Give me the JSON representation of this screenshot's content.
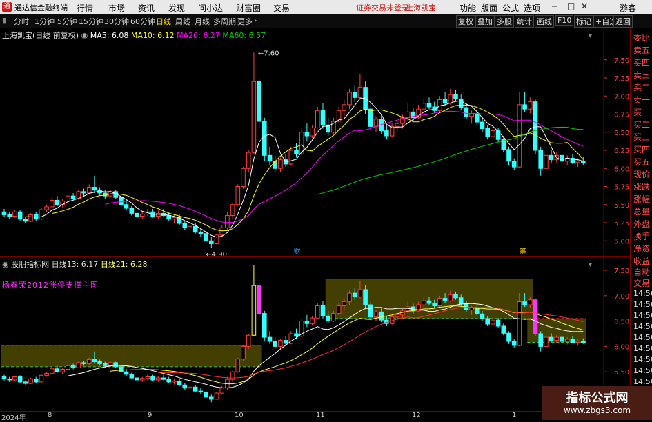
{
  "app": {
    "name": "通达信金融终端",
    "logo": "通"
  },
  "menu": [
    "行情",
    "市场",
    "资讯",
    "发现",
    "问小达",
    "财富圈",
    "交易"
  ],
  "notice": "证券交易未登录",
  "notice_stock": "上海凯宝",
  "right_menu": [
    "功能",
    "版面",
    "公式",
    "选项"
  ],
  "user": "游客",
  "period_tabs": [
    "分时",
    "1分钟",
    "5分钟",
    "15分钟",
    "30分钟",
    "60分钟",
    "日线",
    "周线",
    "月线",
    "多周期",
    "更多"
  ],
  "active_period": "日线",
  "tools": [
    "复权",
    "叠加",
    "多股",
    "统计",
    "画线",
    "F10",
    "标记",
    "+自选",
    "返回"
  ],
  "main_legend": {
    "title": "上海凯宝(日线 前复权)",
    "ma5": "MA5: 6.08",
    "ma10": "MA10: 6.12",
    "ma20": "MA20: 6.27",
    "ma60": "MA60: 6.57"
  },
  "sub_legend": {
    "title": "股朋指标网",
    "l13": "日线13: 6.17",
    "l21": "日线21: 6.28",
    "author": "杨春荣2012涨停支撑主图"
  },
  "main_axis": [
    "7.50",
    "7.25",
    "7.00",
    "6.75",
    "6.50",
    "6.25",
    "6.00",
    "5.75",
    "5.50",
    "5.25",
    "5.00"
  ],
  "sub_axis": [
    "7.50",
    "7.00",
    "6.50",
    "6.00",
    "5.50"
  ],
  "annotations": {
    "high": "7.60",
    "low": "4.90",
    "cai": "财",
    "chou": "筹"
  },
  "side_quote": [
    "委比",
    "卖五",
    "卖四",
    "卖三",
    "卖二",
    "卖一",
    "买一",
    "买二",
    "买三",
    "买四",
    "买五",
    "现价",
    "涨跌",
    "涨幅",
    "总量",
    "外盘",
    "换手",
    "净资",
    "收益"
  ],
  "side_trade": [
    "自动",
    "交易"
  ],
  "side_times": [
    "14:56",
    "14:56",
    "14:56",
    "14:56",
    "14:56",
    "14:56",
    "14:56",
    "14:56",
    "14:56"
  ],
  "dates": [
    "2024年",
    "8",
    "9",
    "10",
    "11",
    "12",
    "1"
  ],
  "watermark": {
    "title": "指标公式网",
    "url": "www.zbgs3.com"
  },
  "colors": {
    "up": "#ff3c3c",
    "down": "#33ffff",
    "ma5": "#ffffff",
    "ma10": "#ffff00",
    "ma20": "#ff00ff",
    "ma60": "#00cc00",
    "zone": "#4d4a00"
  },
  "chart_data": {
    "type": "candlestick",
    "ylim": [
      4.85,
      7.65
    ],
    "candles": [
      [
        5.4,
        5.44,
        5.33,
        5.36
      ],
      [
        5.36,
        5.4,
        5.3,
        5.34
      ],
      [
        5.34,
        5.42,
        5.32,
        5.4
      ],
      [
        5.4,
        5.43,
        5.28,
        5.3
      ],
      [
        5.3,
        5.33,
        5.25,
        5.27
      ],
      [
        5.27,
        5.38,
        5.26,
        5.36
      ],
      [
        5.36,
        5.4,
        5.28,
        5.3
      ],
      [
        5.3,
        5.45,
        5.29,
        5.43
      ],
      [
        5.43,
        5.5,
        5.4,
        5.47
      ],
      [
        5.47,
        5.6,
        5.45,
        5.56
      ],
      [
        5.56,
        5.62,
        5.48,
        5.5
      ],
      [
        5.5,
        5.58,
        5.46,
        5.55
      ],
      [
        5.55,
        5.66,
        5.52,
        5.62
      ],
      [
        5.62,
        5.66,
        5.55,
        5.58
      ],
      [
        5.58,
        5.7,
        5.57,
        5.68
      ],
      [
        5.68,
        5.72,
        5.62,
        5.66
      ],
      [
        5.66,
        5.78,
        5.64,
        5.74
      ],
      [
        5.74,
        5.9,
        5.66,
        5.7
      ],
      [
        5.7,
        5.74,
        5.62,
        5.66
      ],
      [
        5.66,
        5.7,
        5.58,
        5.62
      ],
      [
        5.62,
        5.7,
        5.6,
        5.68
      ],
      [
        5.68,
        5.7,
        5.58,
        5.6
      ],
      [
        5.6,
        5.63,
        5.48,
        5.5
      ],
      [
        5.5,
        5.56,
        5.42,
        5.45
      ],
      [
        5.45,
        5.48,
        5.35,
        5.38
      ],
      [
        5.38,
        5.42,
        5.32,
        5.34
      ],
      [
        5.34,
        5.4,
        5.3,
        5.37
      ],
      [
        5.37,
        5.44,
        5.34,
        5.4
      ],
      [
        5.4,
        5.44,
        5.32,
        5.34
      ],
      [
        5.34,
        5.42,
        5.3,
        5.38
      ],
      [
        5.38,
        5.44,
        5.33,
        5.35
      ],
      [
        5.35,
        5.4,
        5.28,
        5.3
      ],
      [
        5.3,
        5.36,
        5.25,
        5.32
      ],
      [
        5.32,
        5.36,
        5.22,
        5.24
      ],
      [
        5.24,
        5.28,
        5.15,
        5.18
      ],
      [
        5.18,
        5.24,
        5.12,
        5.2
      ],
      [
        5.2,
        5.24,
        5.1,
        5.12
      ],
      [
        5.12,
        5.18,
        5.06,
        5.1
      ],
      [
        5.1,
        5.14,
        4.98,
        5.0
      ],
      [
        5.0,
        5.05,
        4.9,
        4.96
      ],
      [
        4.96,
        5.1,
        4.95,
        5.08
      ],
      [
        5.08,
        5.22,
        5.05,
        5.18
      ],
      [
        5.18,
        5.4,
        5.15,
        5.35
      ],
      [
        5.35,
        5.52,
        5.3,
        5.5
      ],
      [
        5.5,
        5.78,
        5.48,
        5.75
      ],
      [
        5.75,
        6.02,
        5.72,
        6.0
      ],
      [
        6.0,
        6.25,
        5.95,
        6.22
      ],
      [
        6.22,
        7.6,
        6.2,
        7.2
      ],
      [
        7.2,
        7.25,
        6.55,
        6.65
      ],
      [
        6.65,
        6.7,
        6.1,
        6.18
      ],
      [
        6.18,
        6.3,
        6.05,
        6.1
      ],
      [
        6.1,
        6.18,
        5.95,
        6.0
      ],
      [
        6.0,
        6.15,
        5.95,
        6.12
      ],
      [
        6.12,
        6.2,
        6.02,
        6.06
      ],
      [
        6.06,
        6.3,
        6.04,
        6.25
      ],
      [
        6.25,
        6.35,
        6.15,
        6.2
      ],
      [
        6.2,
        6.55,
        6.18,
        6.5
      ],
      [
        6.5,
        6.62,
        6.38,
        6.45
      ],
      [
        6.45,
        6.6,
        6.42,
        6.56
      ],
      [
        6.56,
        6.85,
        6.55,
        6.8
      ],
      [
        6.8,
        6.9,
        6.55,
        6.6
      ],
      [
        6.6,
        6.7,
        6.45,
        6.5
      ],
      [
        6.5,
        6.7,
        6.48,
        6.65
      ],
      [
        6.65,
        6.85,
        6.62,
        6.8
      ],
      [
        6.8,
        6.95,
        6.7,
        6.88
      ],
      [
        6.88,
        7.1,
        6.82,
        7.05
      ],
      [
        7.05,
        7.15,
        6.92,
        6.98
      ],
      [
        6.98,
        7.3,
        6.95,
        7.12
      ],
      [
        7.12,
        7.2,
        6.75,
        6.82
      ],
      [
        6.82,
        6.88,
        6.55,
        6.58
      ],
      [
        6.58,
        6.72,
        6.5,
        6.68
      ],
      [
        6.68,
        6.75,
        6.48,
        6.52
      ],
      [
        6.52,
        6.6,
        6.4,
        6.45
      ],
      [
        6.45,
        6.62,
        6.43,
        6.58
      ],
      [
        6.58,
        6.66,
        6.5,
        6.62
      ],
      [
        6.62,
        6.74,
        6.55,
        6.7
      ],
      [
        6.7,
        6.9,
        6.66,
        6.78
      ],
      [
        6.78,
        6.84,
        6.64,
        6.7
      ],
      [
        6.7,
        6.88,
        6.68,
        6.82
      ],
      [
        6.82,
        6.96,
        6.78,
        6.9
      ],
      [
        6.9,
        6.98,
        6.82,
        6.85
      ],
      [
        6.85,
        6.92,
        6.76,
        6.8
      ],
      [
        6.8,
        7.0,
        6.78,
        6.95
      ],
      [
        6.95,
        7.05,
        6.86,
        6.9
      ],
      [
        6.9,
        7.1,
        6.88,
        7.02
      ],
      [
        7.02,
        7.08,
        6.92,
        6.96
      ],
      [
        6.96,
        7.02,
        6.8,
        6.84
      ],
      [
        6.84,
        6.9,
        6.68,
        6.72
      ],
      [
        6.72,
        6.8,
        6.62,
        6.76
      ],
      [
        6.76,
        6.82,
        6.6,
        6.64
      ],
      [
        6.64,
        6.7,
        6.5,
        6.55
      ],
      [
        6.55,
        6.6,
        6.4,
        6.44
      ],
      [
        6.44,
        6.58,
        6.4,
        6.52
      ],
      [
        6.52,
        6.56,
        6.36,
        6.4
      ],
      [
        6.4,
        6.45,
        6.22,
        6.26
      ],
      [
        6.26,
        6.3,
        6.05,
        6.1
      ],
      [
        6.1,
        6.14,
        5.98,
        6.02
      ],
      [
        6.02,
        7.05,
        6.0,
        6.88
      ],
      [
        6.88,
        7.05,
        6.78,
        6.82
      ],
      [
        6.82,
        6.98,
        6.76,
        6.92
      ],
      [
        6.92,
        6.95,
        6.2,
        6.25
      ],
      [
        6.25,
        6.3,
        5.9,
        6.0
      ],
      [
        6.0,
        6.2,
        5.95,
        6.18
      ],
      [
        6.18,
        6.26,
        6.08,
        6.12
      ],
      [
        6.12,
        6.22,
        6.08,
        6.18
      ],
      [
        6.18,
        6.22,
        6.05,
        6.1
      ],
      [
        6.1,
        6.18,
        6.04,
        6.14
      ],
      [
        6.14,
        6.2,
        6.06,
        6.08
      ],
      [
        6.08,
        6.14,
        6.02,
        6.1
      ],
      [
        6.1,
        6.16,
        6.05,
        6.08
      ]
    ],
    "sub_zones": [
      {
        "x_from": 0,
        "x_to": 48,
        "top": 6.02,
        "bottom": 5.6
      },
      {
        "x_from": 61,
        "x_to": 99,
        "top": 7.33,
        "bottom": 6.55
      },
      {
        "x_from": 99,
        "x_to": 109,
        "top": 6.55,
        "bottom": 6.08
      }
    ]
  }
}
